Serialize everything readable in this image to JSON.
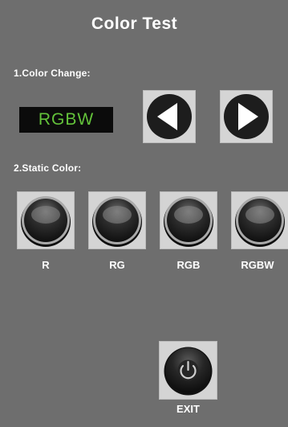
{
  "title": "Color Test",
  "color_change": {
    "label": "1.Color Change:",
    "display_value": "RGBW",
    "prev_icon": "left-arrow-icon",
    "next_icon": "right-arrow-icon"
  },
  "static_color": {
    "label": "2.Static Color:",
    "buttons": [
      {
        "label": "R"
      },
      {
        "label": "RG"
      },
      {
        "label": "RGB"
      },
      {
        "label": "RGBW"
      }
    ]
  },
  "exit": {
    "label": "EXIT",
    "icon": "power-icon"
  },
  "colors": {
    "background": "#6e6e6e",
    "display_bg": "#0b0b0b",
    "display_text": "#63c23a",
    "button_face": "#d4d4d4",
    "button_knob": "#2a2a2a"
  }
}
